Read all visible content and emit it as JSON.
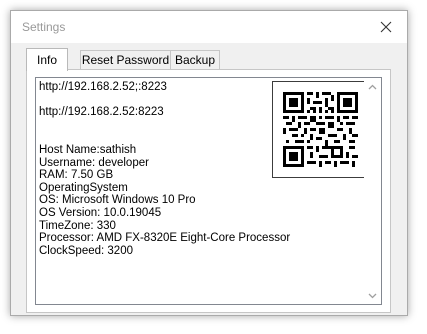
{
  "window": {
    "title": "Settings"
  },
  "tabs": [
    {
      "label": "Info",
      "active": true
    },
    {
      "label": "Reset Password",
      "active": false
    },
    {
      "label": "Backup",
      "active": false
    }
  ],
  "info": {
    "lines": [
      "http://192.168.2.52;:8223",
      "",
      "http://192.168.2.52:8223",
      "",
      "",
      "Host Name:sathish",
      "Username: developer",
      "RAM: 7.50 GB",
      "OperatingSystem",
      "OS: Microsoft Windows 10 Pro",
      "OS Version: 10.0.19045",
      "TimeZone: 330",
      "Processor: AMD FX-8320E Eight-Core Processor",
      "ClockSpeed: 3200"
    ]
  },
  "icons": {
    "close": "close-icon",
    "qr": "qr-code-icon",
    "scroll_up": "chevron-up-icon",
    "scroll_down": "chevron-down-icon"
  },
  "colors": {
    "window_bg": "#f0f0f0",
    "title_text": "#999999",
    "border": "#c6c6c6"
  }
}
